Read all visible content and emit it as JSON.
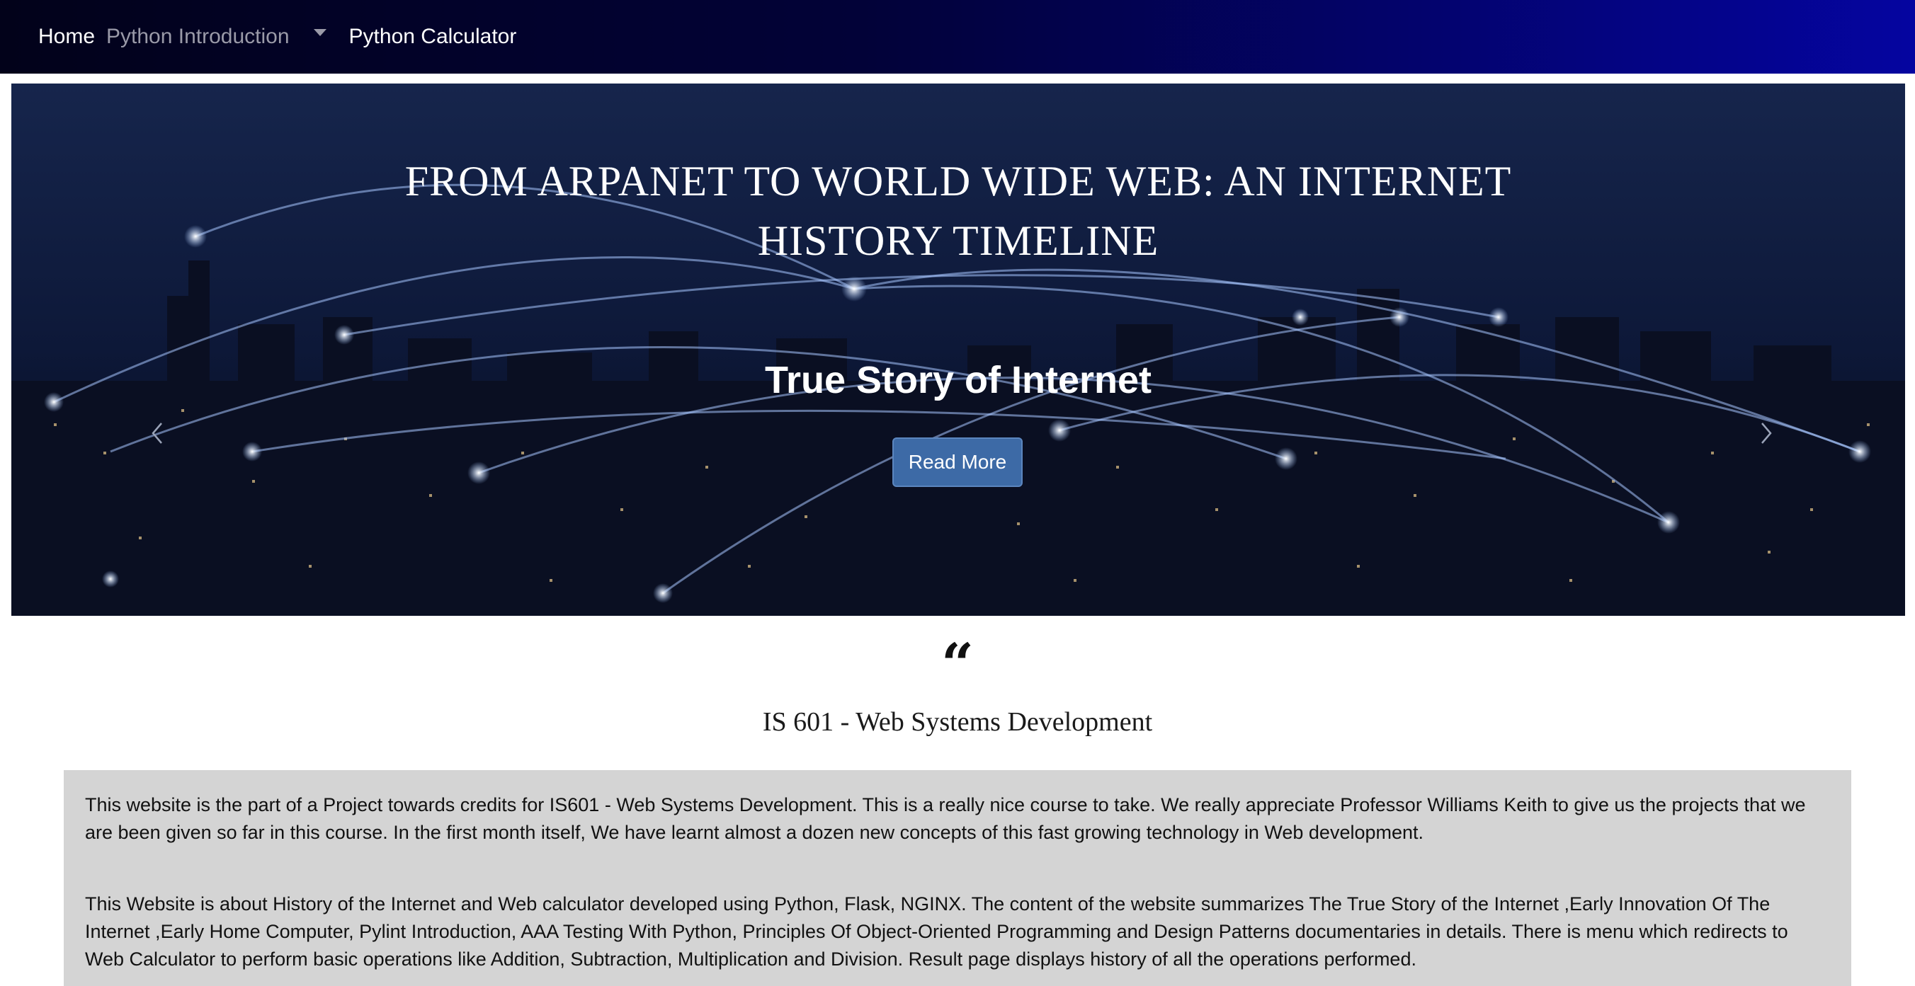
{
  "nav": {
    "home": "Home",
    "python_intro": "Python Introduction",
    "calculator": "Python Calculator"
  },
  "carousel": {
    "title_line1": "FROM ARPANET TO WORLD WIDE WEB: AN INTERNET",
    "title_line2": "HISTORY TIMELINE",
    "caption": "True Story of Internet",
    "button_label": "Read More",
    "slide_count": 3,
    "active_slide": 1
  },
  "intro": {
    "quote_mark": "“",
    "course_title": "IS 601 - Web Systems Development",
    "paragraph1": "This website is the part of a Project towards credits for IS601 - Web Systems Development. This is a really nice course to take. We really appreciate Professor Williams Keith to give us the projects that we are been given so far in this course. In the first month itself, We have learnt almost a dozen new concepts of this fast growing technology in Web development.",
    "paragraph2": "This Website is about History of the Internet and Web calculator developed using Python, Flask, NGINX. The content of the website summarizes The True Story of the Internet ,Early Innovation Of The Internet ,Early Home Computer, Pylint Introduction, AAA Testing With Python, Principles Of Object-Oriented Programming and Design Patterns documentaries in details. There is menu which redirects to Web Calculator to perform basic operations like Addition, Subtraction, Multiplication and Division. Result page displays history of all the operations performed."
  },
  "colors": {
    "navbar_start": "#02021a",
    "navbar_end": "#0505a0",
    "button": "#3d6aa6",
    "content_bg": "#d4d4d4"
  }
}
